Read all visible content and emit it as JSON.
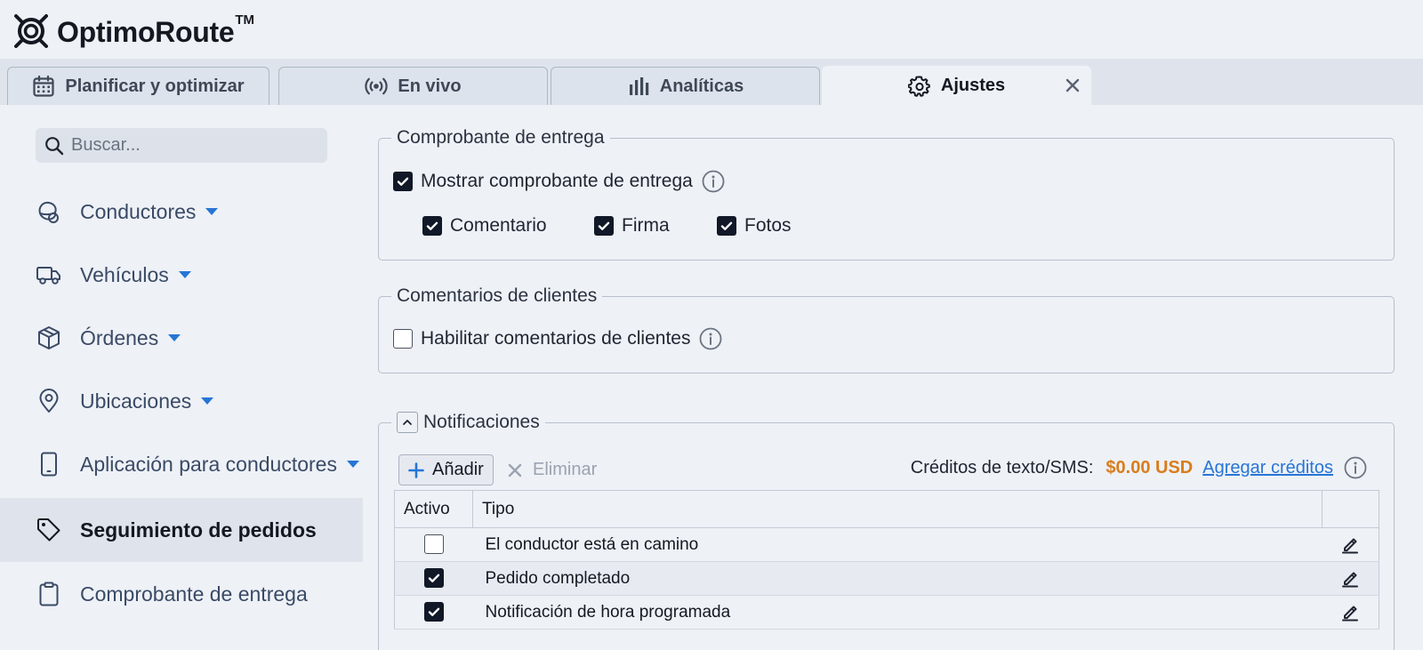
{
  "header": {
    "brand": "OptimoRoute",
    "trademark": "TM"
  },
  "tabs": [
    {
      "label": "Planificar y optimizar",
      "icon": "calendar-icon",
      "active": false
    },
    {
      "label": "En vivo",
      "icon": "broadcast-icon",
      "active": false
    },
    {
      "label": "Analíticas",
      "icon": "bar-chart-icon",
      "active": false
    },
    {
      "label": "Ajustes",
      "icon": "gear-icon",
      "active": true
    }
  ],
  "sidebar": {
    "search_placeholder": "Buscar...",
    "items": [
      {
        "label": "Conductores",
        "icon": "driver-icon",
        "has_caret": true
      },
      {
        "label": "Vehículos",
        "icon": "truck-icon",
        "has_caret": true
      },
      {
        "label": "Órdenes",
        "icon": "package-icon",
        "has_caret": true
      },
      {
        "label": "Ubicaciones",
        "icon": "location-pin-icon",
        "has_caret": true
      },
      {
        "label": "Aplicación para conductores",
        "icon": "phone-icon",
        "has_caret": true
      },
      {
        "label": "Seguimiento de pedidos",
        "icon": "tag-icon",
        "has_caret": false,
        "active": true
      },
      {
        "label": "Comprobante de entrega",
        "icon": "clipboard-icon",
        "has_caret": false
      }
    ]
  },
  "proof": {
    "legend": "Comprobante de entrega",
    "show_label": "Mostrar comprobante de entrega",
    "show_checked": true,
    "options": [
      {
        "label": "Comentario",
        "checked": true
      },
      {
        "label": "Firma",
        "checked": true
      },
      {
        "label": "Fotos",
        "checked": true
      }
    ]
  },
  "feedback": {
    "legend": "Comentarios de clientes",
    "enable_label": "Habilitar comentarios de clientes",
    "enable_checked": false
  },
  "notifications": {
    "legend": "Notificaciones",
    "add_label": "Añadir",
    "delete_label": "Eliminar",
    "credits_label": "Créditos de texto/SMS:",
    "credits_amount": "$0.00 USD",
    "add_credits_label": "Agregar créditos",
    "columns": [
      "Activo",
      "Tipo"
    ],
    "rows": [
      {
        "active": false,
        "type": "El conductor está en camino"
      },
      {
        "active": true,
        "type": "Pedido completado"
      },
      {
        "active": true,
        "type": "Notificación de hora programada"
      }
    ]
  },
  "colors": {
    "accent_blue": "#2675d6",
    "credits_orange": "#d97d1c",
    "checkbox_dark": "#111827"
  }
}
